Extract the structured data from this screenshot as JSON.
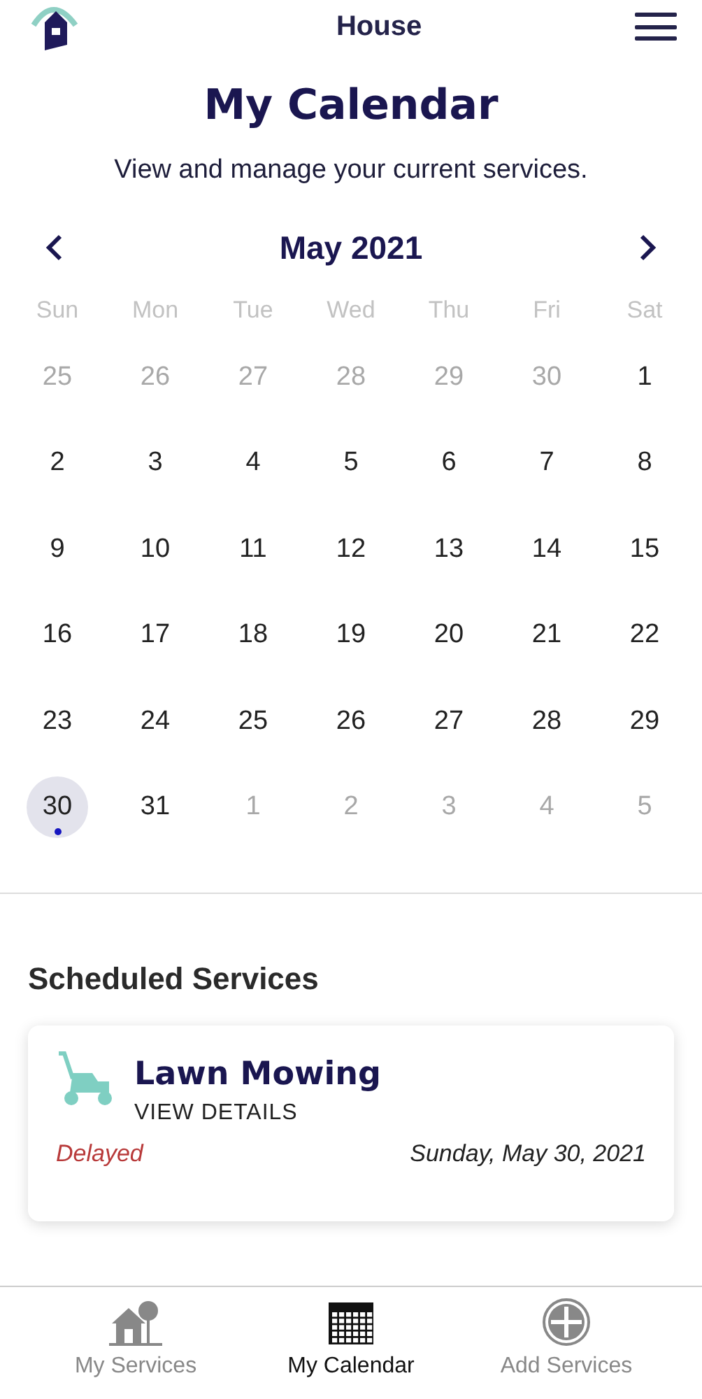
{
  "header": {
    "title": "House"
  },
  "page": {
    "title": "My Calendar",
    "subtitle": "View and manage your current services."
  },
  "calendar": {
    "month": "May 2021",
    "weekdays": [
      "Sun",
      "Mon",
      "Tue",
      "Wed",
      "Thu",
      "Fri",
      "Sat"
    ],
    "days": [
      {
        "label": "25",
        "in_month": false,
        "selected": false,
        "has_event": false
      },
      {
        "label": "26",
        "in_month": false,
        "selected": false,
        "has_event": false
      },
      {
        "label": "27",
        "in_month": false,
        "selected": false,
        "has_event": false
      },
      {
        "label": "28",
        "in_month": false,
        "selected": false,
        "has_event": false
      },
      {
        "label": "29",
        "in_month": false,
        "selected": false,
        "has_event": false
      },
      {
        "label": "30",
        "in_month": false,
        "selected": false,
        "has_event": false
      },
      {
        "label": "1",
        "in_month": true,
        "selected": false,
        "has_event": false
      },
      {
        "label": "2",
        "in_month": true,
        "selected": false,
        "has_event": false
      },
      {
        "label": "3",
        "in_month": true,
        "selected": false,
        "has_event": false
      },
      {
        "label": "4",
        "in_month": true,
        "selected": false,
        "has_event": false
      },
      {
        "label": "5",
        "in_month": true,
        "selected": false,
        "has_event": false
      },
      {
        "label": "6",
        "in_month": true,
        "selected": false,
        "has_event": false
      },
      {
        "label": "7",
        "in_month": true,
        "selected": false,
        "has_event": false
      },
      {
        "label": "8",
        "in_month": true,
        "selected": false,
        "has_event": false
      },
      {
        "label": "9",
        "in_month": true,
        "selected": false,
        "has_event": false
      },
      {
        "label": "10",
        "in_month": true,
        "selected": false,
        "has_event": false
      },
      {
        "label": "11",
        "in_month": true,
        "selected": false,
        "has_event": false
      },
      {
        "label": "12",
        "in_month": true,
        "selected": false,
        "has_event": false
      },
      {
        "label": "13",
        "in_month": true,
        "selected": false,
        "has_event": false
      },
      {
        "label": "14",
        "in_month": true,
        "selected": false,
        "has_event": false
      },
      {
        "label": "15",
        "in_month": true,
        "selected": false,
        "has_event": false
      },
      {
        "label": "16",
        "in_month": true,
        "selected": false,
        "has_event": false
      },
      {
        "label": "17",
        "in_month": true,
        "selected": false,
        "has_event": false
      },
      {
        "label": "18",
        "in_month": true,
        "selected": false,
        "has_event": false
      },
      {
        "label": "19",
        "in_month": true,
        "selected": false,
        "has_event": false
      },
      {
        "label": "20",
        "in_month": true,
        "selected": false,
        "has_event": false
      },
      {
        "label": "21",
        "in_month": true,
        "selected": false,
        "has_event": false
      },
      {
        "label": "22",
        "in_month": true,
        "selected": false,
        "has_event": false
      },
      {
        "label": "23",
        "in_month": true,
        "selected": false,
        "has_event": false
      },
      {
        "label": "24",
        "in_month": true,
        "selected": false,
        "has_event": false
      },
      {
        "label": "25",
        "in_month": true,
        "selected": false,
        "has_event": false
      },
      {
        "label": "26",
        "in_month": true,
        "selected": false,
        "has_event": false
      },
      {
        "label": "27",
        "in_month": true,
        "selected": false,
        "has_event": false
      },
      {
        "label": "28",
        "in_month": true,
        "selected": false,
        "has_event": false
      },
      {
        "label": "29",
        "in_month": true,
        "selected": false,
        "has_event": false
      },
      {
        "label": "30",
        "in_month": true,
        "selected": true,
        "has_event": true
      },
      {
        "label": "31",
        "in_month": true,
        "selected": false,
        "has_event": false
      },
      {
        "label": "1",
        "in_month": false,
        "selected": false,
        "has_event": false
      },
      {
        "label": "2",
        "in_month": false,
        "selected": false,
        "has_event": false
      },
      {
        "label": "3",
        "in_month": false,
        "selected": false,
        "has_event": false
      },
      {
        "label": "4",
        "in_month": false,
        "selected": false,
        "has_event": false
      },
      {
        "label": "5",
        "in_month": false,
        "selected": false,
        "has_event": false
      }
    ]
  },
  "scheduled": {
    "heading": "Scheduled Services",
    "services": [
      {
        "name": "Lawn Mowing",
        "link": "VIEW DETAILS",
        "status": "Delayed",
        "date": "Sunday, May 30, 2021"
      }
    ]
  },
  "tab_bar": [
    {
      "kind": "house",
      "label": "My Services",
      "selected": false
    },
    {
      "kind": "calendar",
      "label": "My Calendar",
      "selected": true
    },
    {
      "kind": "add",
      "label": "Add Services",
      "selected": false
    }
  ]
}
